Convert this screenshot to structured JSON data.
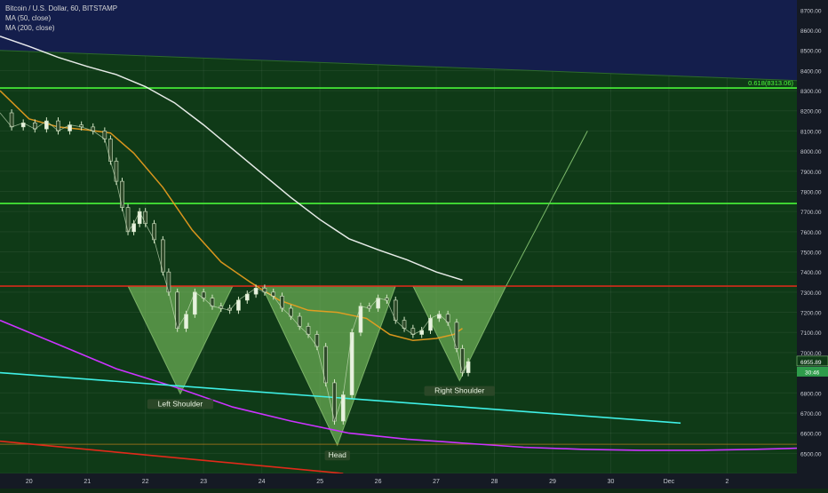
{
  "header": {
    "symbol_title": "Bitcoin / U.S. Dollar, 60, BITSTAMP",
    "indicators": [
      "MA (50, close)",
      "MA (200, close)"
    ]
  },
  "colors": {
    "background_green": "#0f3a17",
    "background_navy": "#141e4c",
    "resistance_red": "#e02a1a",
    "support_green": "#4cff3a",
    "ma50": "#f0a01e",
    "ma200": "#ffffff",
    "ma_magenta": "#cc33ff",
    "trend_cyan": "#3ff0e6",
    "pattern_fill": "#8ad46a"
  },
  "chart_data": {
    "type": "line",
    "title": "Bitcoin / U.S. Dollar, 60, BITSTAMP",
    "x_axis": {
      "tick_labels": [
        "20",
        "21",
        "22",
        "23",
        "24",
        "25",
        "26",
        "27",
        "28",
        "29",
        "30",
        "Dec",
        "2"
      ],
      "range_days": [
        19.5,
        33.2
      ]
    },
    "y_axis": {
      "range": [
        6400,
        8750
      ],
      "tick_labels": [
        "6400.00",
        "6500.00",
        "6600.00",
        "6700.00",
        "6800.00",
        "6900.00",
        "7000.00",
        "7100.00",
        "7200.00",
        "7300.00",
        "7400.00",
        "7500.00",
        "7600.00",
        "7700.00",
        "7800.00",
        "7900.00",
        "8000.00",
        "8100.00",
        "8200.00",
        "8300.00",
        "8400.00",
        "8500.00",
        "8600.00",
        "8700.00"
      ]
    },
    "price_labels": {
      "last_price": "6955.89",
      "countdown": "30:46",
      "fib_level": "0.618(8313.06)"
    },
    "horizontal_levels": [
      {
        "price": 8313.06,
        "label": "0.618(8313.06)",
        "color": "#4cff3a"
      },
      {
        "price": 7740,
        "label": "",
        "color": "#4cff3a"
      },
      {
        "price": 7330,
        "label": "",
        "color": "#e02a1a"
      },
      {
        "price": 6545,
        "label": "",
        "color": "#e08a1a"
      }
    ],
    "price_series": [
      [
        19.5,
        8190
      ],
      [
        19.7,
        8120
      ],
      [
        19.9,
        8140
      ],
      [
        20.1,
        8110
      ],
      [
        20.3,
        8150
      ],
      [
        20.5,
        8100
      ],
      [
        20.7,
        8130
      ],
      [
        20.9,
        8120
      ],
      [
        21.1,
        8100
      ],
      [
        21.3,
        8060
      ],
      [
        21.4,
        7950
      ],
      [
        21.5,
        7850
      ],
      [
        21.6,
        7720
      ],
      [
        21.7,
        7600
      ],
      [
        21.8,
        7640
      ],
      [
        21.9,
        7700
      ],
      [
        22.0,
        7640
      ],
      [
        22.15,
        7560
      ],
      [
        22.3,
        7400
      ],
      [
        22.4,
        7300
      ],
      [
        22.55,
        7120
      ],
      [
        22.7,
        7190
      ],
      [
        22.85,
        7300
      ],
      [
        23.0,
        7270
      ],
      [
        23.15,
        7230
      ],
      [
        23.3,
        7220
      ],
      [
        23.45,
        7210
      ],
      [
        23.6,
        7260
      ],
      [
        23.75,
        7290
      ],
      [
        23.9,
        7320
      ],
      [
        24.05,
        7300
      ],
      [
        24.2,
        7280
      ],
      [
        24.35,
        7220
      ],
      [
        24.5,
        7180
      ],
      [
        24.65,
        7130
      ],
      [
        24.8,
        7090
      ],
      [
        24.95,
        7030
      ],
      [
        25.1,
        6850
      ],
      [
        25.25,
        6660
      ],
      [
        25.4,
        6790
      ],
      [
        25.55,
        7100
      ],
      [
        25.7,
        7230
      ],
      [
        25.85,
        7220
      ],
      [
        26.0,
        7270
      ],
      [
        26.15,
        7260
      ],
      [
        26.3,
        7160
      ],
      [
        26.45,
        7120
      ],
      [
        26.6,
        7090
      ],
      [
        26.75,
        7110
      ],
      [
        26.9,
        7170
      ],
      [
        27.05,
        7190
      ],
      [
        27.2,
        7150
      ],
      [
        27.35,
        7020
      ],
      [
        27.45,
        6900
      ],
      [
        27.55,
        6955
      ]
    ],
    "ma_series": [
      {
        "name": "MA (50, close)",
        "color": "#f0a01e",
        "points": [
          [
            19.5,
            8300
          ],
          [
            20.0,
            8160
          ],
          [
            20.5,
            8120
          ],
          [
            21.0,
            8105
          ],
          [
            21.4,
            8090
          ],
          [
            21.8,
            7990
          ],
          [
            22.3,
            7820
          ],
          [
            22.8,
            7610
          ],
          [
            23.3,
            7450
          ],
          [
            23.8,
            7350
          ],
          [
            24.3,
            7260
          ],
          [
            24.8,
            7210
          ],
          [
            25.3,
            7200
          ],
          [
            25.8,
            7170
          ],
          [
            26.2,
            7090
          ],
          [
            26.6,
            7060
          ],
          [
            27.0,
            7070
          ],
          [
            27.3,
            7090
          ],
          [
            27.45,
            7120
          ]
        ]
      },
      {
        "name": "MA (200, close)",
        "color": "#ffffff",
        "points": [
          [
            19.5,
            8570
          ],
          [
            20.0,
            8520
          ],
          [
            20.5,
            8465
          ],
          [
            21.0,
            8420
          ],
          [
            21.5,
            8380
          ],
          [
            22.0,
            8320
          ],
          [
            22.5,
            8240
          ],
          [
            23.0,
            8130
          ],
          [
            23.5,
            8010
          ],
          [
            24.0,
            7890
          ],
          [
            24.5,
            7770
          ],
          [
            25.0,
            7660
          ],
          [
            25.5,
            7565
          ],
          [
            26.0,
            7510
          ],
          [
            26.5,
            7460
          ],
          [
            27.0,
            7400
          ],
          [
            27.45,
            7360
          ]
        ]
      }
    ],
    "trend_lines": [
      {
        "name": "upper-channel",
        "color": "#2d6a2b",
        "points": [
          [
            19.5,
            8500
          ],
          [
            33.2,
            8350
          ]
        ]
      },
      {
        "name": "magenta-curve",
        "color": "#cc33ff",
        "points": [
          [
            19.5,
            7160
          ],
          [
            20.5,
            7040
          ],
          [
            21.5,
            6920
          ],
          [
            22.5,
            6830
          ],
          [
            23.5,
            6730
          ],
          [
            24.5,
            6660
          ],
          [
            25.5,
            6600
          ],
          [
            26.5,
            6570
          ],
          [
            27.5,
            6550
          ],
          [
            28.5,
            6530
          ],
          [
            29.5,
            6520
          ],
          [
            30.5,
            6515
          ],
          [
            31.5,
            6515
          ],
          [
            32.5,
            6520
          ],
          [
            33.2,
            6525
          ]
        ]
      },
      {
        "name": "cyan-trendline",
        "color": "#3ff0e6",
        "points": [
          [
            19.5,
            6900
          ],
          [
            31.2,
            6650
          ]
        ]
      },
      {
        "name": "red-trendline",
        "color": "#e02a1a",
        "points": [
          [
            19.5,
            6560
          ],
          [
            25.4,
            6400
          ]
        ]
      },
      {
        "name": "projection",
        "color": "#7bb86a",
        "points": [
          [
            28.2,
            7330
          ],
          [
            29.6,
            8100
          ]
        ]
      }
    ],
    "pattern": {
      "name": "inverse head and shoulders",
      "neckline": 7330,
      "shapes": [
        {
          "label": "Left Shoulder",
          "apex": [
            22.6,
            6795
          ],
          "base": [
            21.7,
            23.5
          ]
        },
        {
          "label": "Head",
          "apex": [
            25.3,
            6540
          ],
          "base": [
            24.0,
            26.3
          ]
        },
        {
          "label": "Right Shoulder",
          "apex": [
            27.4,
            6860
          ],
          "base": [
            26.6,
            28.2
          ]
        }
      ]
    },
    "grid": true
  }
}
